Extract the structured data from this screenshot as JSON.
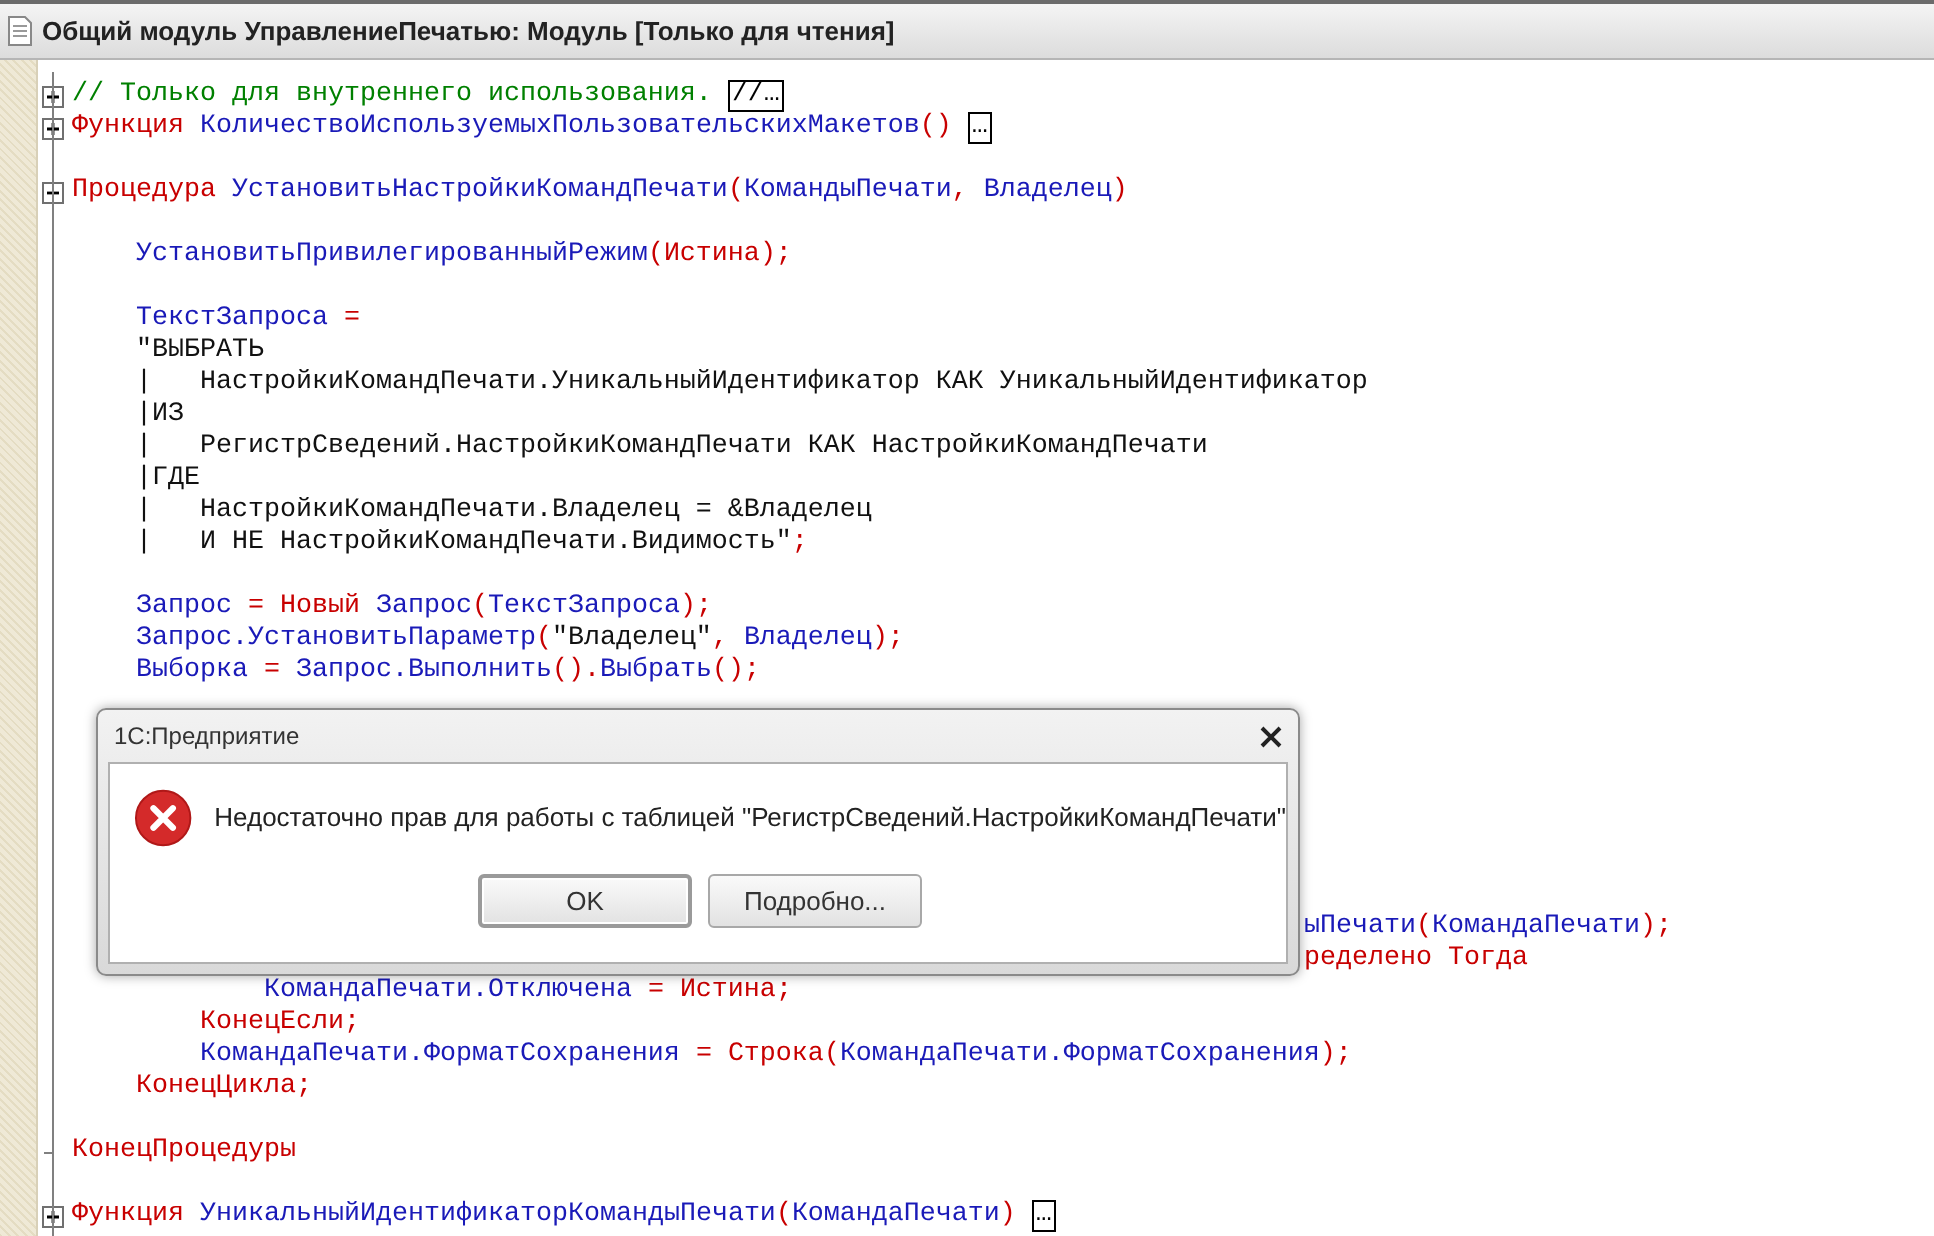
{
  "window": {
    "title": "Общий модуль УправлениеПечатью: Модуль [Только для чтения]"
  },
  "editor": {
    "lines_above": [
      {
        "kind": "code",
        "expanded": false,
        "tokens": [
          {
            "kind": "comment",
            "text": "// Только для внутреннего использования. "
          }
        ],
        "collapsed": "//…"
      },
      {
        "kind": "code",
        "expanded": false,
        "tokens": [
          {
            "kind": "keyword",
            "text": "Функция "
          },
          {
            "kind": "ident",
            "text": "КоличествоИспользуемыхПользовательскихМакетов"
          },
          {
            "kind": "op",
            "text": "() "
          }
        ],
        "collapsed": "…"
      },
      {
        "kind": "blank"
      },
      {
        "kind": "code",
        "expanded": true,
        "tokens": [
          {
            "kind": "keyword",
            "text": "Процедура "
          },
          {
            "kind": "ident",
            "text": "УстановитьНастройкиКомандПечати"
          },
          {
            "kind": "op",
            "text": "("
          },
          {
            "kind": "ident",
            "text": "КомандыПечати"
          },
          {
            "kind": "op",
            "text": ", "
          },
          {
            "kind": "ident",
            "text": "Владелец"
          },
          {
            "kind": "op",
            "text": ")"
          }
        ]
      },
      {
        "kind": "blank"
      },
      {
        "kind": "code",
        "tokens": [
          {
            "kind": "ident",
            "text": "    УстановитьПривилегированныйРежим"
          },
          {
            "kind": "op",
            "text": "("
          },
          {
            "kind": "keyword",
            "text": "Истина"
          },
          {
            "kind": "op",
            "text": ");"
          }
        ]
      },
      {
        "kind": "blank"
      },
      {
        "kind": "code",
        "tokens": [
          {
            "kind": "ident",
            "text": "    ТекстЗапроса "
          },
          {
            "kind": "op",
            "text": "="
          }
        ]
      },
      {
        "kind": "code",
        "tokens": [
          {
            "kind": "string",
            "text": "    \"ВЫБРАТЬ"
          }
        ]
      },
      {
        "kind": "code",
        "tokens": [
          {
            "kind": "string",
            "text": "    |   НастройкиКомандПечати.УникальныйИдентификатор КАК УникальныйИдентификатор"
          }
        ]
      },
      {
        "kind": "code",
        "tokens": [
          {
            "kind": "string",
            "text": "    |ИЗ"
          }
        ]
      },
      {
        "kind": "code",
        "tokens": [
          {
            "kind": "string",
            "text": "    |   РегистрСведений.НастройкиКомандПечати КАК НастройкиКомандПечати"
          }
        ]
      },
      {
        "kind": "code",
        "tokens": [
          {
            "kind": "string",
            "text": "    |ГДЕ"
          }
        ]
      },
      {
        "kind": "code",
        "tokens": [
          {
            "kind": "string",
            "text": "    |   НастройкиКомандПечати.Владелец = &Владелец"
          }
        ]
      },
      {
        "kind": "code",
        "tokens": [
          {
            "kind": "string",
            "text": "    |   И НЕ НастройкиКомандПечати.Видимость\""
          },
          {
            "kind": "op",
            "text": ";"
          }
        ]
      },
      {
        "kind": "blank"
      },
      {
        "kind": "code",
        "tokens": [
          {
            "kind": "ident",
            "text": "    Запрос "
          },
          {
            "kind": "op",
            "text": "= "
          },
          {
            "kind": "keyword",
            "text": "Новый "
          },
          {
            "kind": "ident",
            "text": "Запрос"
          },
          {
            "kind": "op",
            "text": "("
          },
          {
            "kind": "ident",
            "text": "ТекстЗапроса"
          },
          {
            "kind": "op",
            "text": ");"
          }
        ]
      },
      {
        "kind": "code",
        "tokens": [
          {
            "kind": "ident",
            "text": "    Запрос.УстановитьПараметр"
          },
          {
            "kind": "op",
            "text": "("
          },
          {
            "kind": "string",
            "text": "\"Владелец\""
          },
          {
            "kind": "op",
            "text": ", "
          },
          {
            "kind": "ident",
            "text": "Владелец"
          },
          {
            "kind": "op",
            "text": ");"
          }
        ]
      },
      {
        "kind": "code",
        "tokens": [
          {
            "kind": "ident",
            "text": "    Выборка "
          },
          {
            "kind": "op",
            "text": "= "
          },
          {
            "kind": "ident",
            "text": "Запрос.Выполнить"
          },
          {
            "kind": "op",
            "text": "()."
          },
          {
            "kind": "ident",
            "text": "Выбрать"
          },
          {
            "kind": "op",
            "text": "();"
          }
        ]
      }
    ],
    "lines_right_of_dialog": [
      {
        "kind": "code",
        "tokens": [
          {
            "kind": "ident",
            "text": "ыПечати"
          },
          {
            "kind": "op",
            "text": "("
          },
          {
            "kind": "ident",
            "text": "КомандаПечати"
          },
          {
            "kind": "op",
            "text": ");"
          }
        ]
      },
      {
        "kind": "code",
        "tokens": [
          {
            "kind": "keyword",
            "text": "ределено Тогда"
          }
        ]
      }
    ],
    "lines_below": [
      {
        "kind": "code",
        "tokens": [
          {
            "kind": "ident",
            "text": "            КомандаПечати.Отключена "
          },
          {
            "kind": "op",
            "text": "= "
          },
          {
            "kind": "keyword",
            "text": "Истина"
          },
          {
            "kind": "op",
            "text": ";"
          }
        ]
      },
      {
        "kind": "code",
        "tokens": [
          {
            "kind": "keyword",
            "text": "        КонецЕсли"
          },
          {
            "kind": "op",
            "text": ";"
          }
        ]
      },
      {
        "kind": "code",
        "tokens": [
          {
            "kind": "ident",
            "text": "        КомандаПечати.ФорматСохранения "
          },
          {
            "kind": "op",
            "text": "= "
          },
          {
            "kind": "keyword",
            "text": "Строка"
          },
          {
            "kind": "op",
            "text": "("
          },
          {
            "kind": "ident",
            "text": "КомандаПечати.ФорматСохранения"
          },
          {
            "kind": "op",
            "text": ");"
          }
        ]
      },
      {
        "kind": "code",
        "tokens": [
          {
            "kind": "keyword",
            "text": "    КонецЦикла"
          },
          {
            "kind": "op",
            "text": ";"
          }
        ]
      },
      {
        "kind": "blank"
      },
      {
        "kind": "code",
        "block_end": true,
        "tokens": [
          {
            "kind": "keyword",
            "text": "КонецПроцедуры"
          }
        ]
      },
      {
        "kind": "blank"
      },
      {
        "kind": "code",
        "expanded": false,
        "tokens": [
          {
            "kind": "keyword",
            "text": "Функция "
          },
          {
            "kind": "ident",
            "text": "УникальныйИдентификаторКомандыПечати"
          },
          {
            "kind": "op",
            "text": "("
          },
          {
            "kind": "ident",
            "text": "КомандаПечати"
          },
          {
            "kind": "op",
            "text": ") "
          }
        ],
        "collapsed": "…"
      }
    ]
  },
  "dialog": {
    "title": "1С:Предприятие",
    "message": "Недостаточно прав для работы с таблицей \"РегистрСведений.НастройкиКомандПечати\"",
    "buttons": [
      {
        "label": "OK",
        "selected": true
      },
      {
        "label": "Подробно...",
        "selected": false
      }
    ]
  }
}
